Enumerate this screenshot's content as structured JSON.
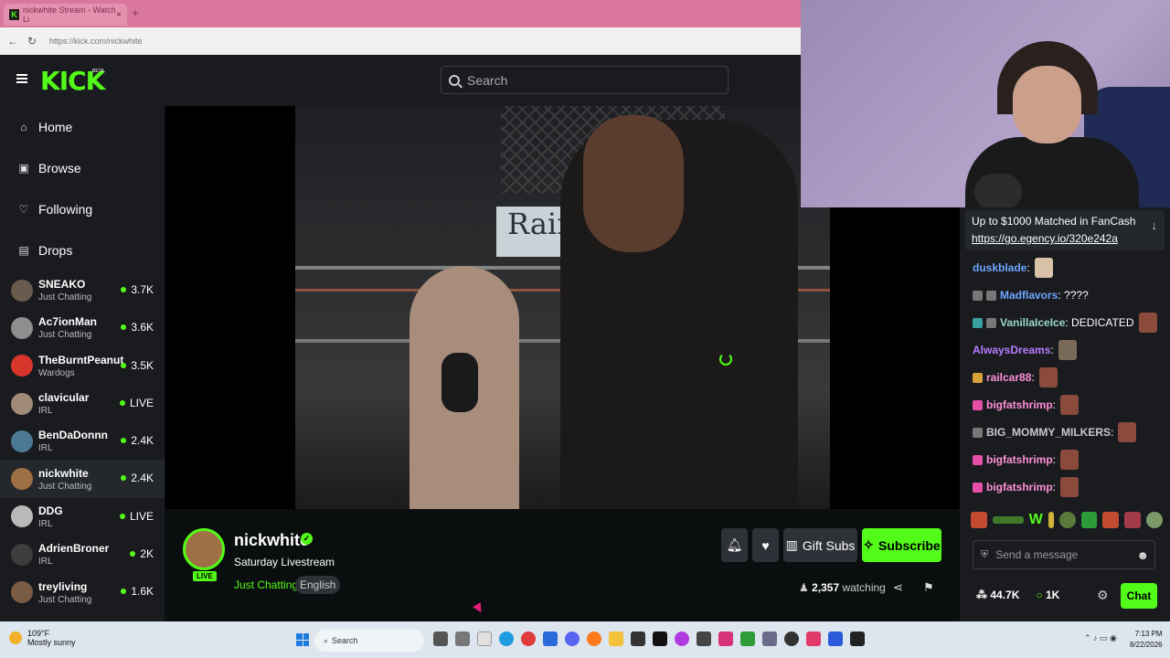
{
  "browser": {
    "tab_title": "nickwhite Stream - Watch Li",
    "tab_close": "×",
    "new_tab": "+",
    "url": "https://kick.com/nickwhite"
  },
  "kick": {
    "logo": "KICK",
    "beta": "BETA",
    "search_placeholder": "Search"
  },
  "sidebar": {
    "nav": [
      {
        "label": "Home",
        "icon": "home-icon"
      },
      {
        "label": "Browse",
        "icon": "browse-icon"
      },
      {
        "label": "Following",
        "icon": "heart-icon"
      },
      {
        "label": "Drops",
        "icon": "drops-icon"
      }
    ],
    "channels": [
      {
        "name": "SNEAKO",
        "category": "Just Chatting",
        "viewers": "3.7K",
        "live": false
      },
      {
        "name": "Ac7ionMan",
        "category": "Just Chatting",
        "viewers": "3.6K",
        "live": false
      },
      {
        "name": "TheBurntPeanut",
        "category": "Wardogs",
        "viewers": "3.5K",
        "live": false
      },
      {
        "name": "clavicular",
        "category": "IRL",
        "viewers": "LIVE",
        "live": true
      },
      {
        "name": "BenDaDonnn",
        "category": "IRL",
        "viewers": "2.4K",
        "live": false
      },
      {
        "name": "nickwhite",
        "category": "Just Chatting",
        "viewers": "2.4K",
        "live": false
      },
      {
        "name": "DDG",
        "category": "IRL",
        "viewers": "LIVE",
        "live": true
      },
      {
        "name": "AdrienBroner",
        "category": "IRL",
        "viewers": "2K",
        "live": false
      },
      {
        "name": "treyliving",
        "category": "Just Chatting",
        "viewers": "1.6K",
        "live": false
      }
    ]
  },
  "video": {
    "banner_text": "Rain"
  },
  "stream": {
    "streamer": "nickwhite",
    "live_badge": "LIVE",
    "title": "Saturday Livestream",
    "category": "Just Chatting",
    "tag": "English",
    "gift_label": "Gift Subs",
    "subscribe_label": "Subscribe",
    "viewer_count": "2,357",
    "watching_label": "watching"
  },
  "chat": {
    "pinned_text": "Up to $1000 Matched in FanCash",
    "pinned_link": "https://go.egency.io/320e242a",
    "messages": [
      {
        "user": "duskblade",
        "text": ":",
        "color": "#6ea6ff"
      },
      {
        "user": "Madflavors",
        "text": ": ????",
        "color": "#6ea6ff"
      },
      {
        "user": "VanillaIceIce",
        "text": ": DEDICATED",
        "color": "#9ad8c8"
      },
      {
        "user": "AlwaysDreams",
        "text": ":",
        "color": "#b77cff"
      },
      {
        "user": "railcar88",
        "text": ":",
        "color": "#ff8fd6"
      },
      {
        "user": "bigfatshrimp",
        "text": ":",
        "color": "#ff8fd6"
      },
      {
        "user": "BIG_MOMMY_MILKERS",
        "text": ":",
        "color": "#c9c9c9"
      },
      {
        "user": "bigfatshrimp",
        "text": ":",
        "color": "#ff8fd6"
      },
      {
        "user": "bigfatshrimp",
        "text": ":",
        "color": "#ff8fd6"
      }
    ],
    "input_placeholder": "Send a message",
    "kick_points": "44.7K",
    "drops_count": "1K",
    "chat_button": "Chat",
    "emote_w": "W"
  },
  "taskbar": {
    "temp": "109°F",
    "weather": "Mostly sunny",
    "search": "Search",
    "time": "7:13 PM",
    "date": "8/22/2026"
  },
  "colors": {
    "accent": "#53fc18",
    "panel": "#191b1f"
  }
}
